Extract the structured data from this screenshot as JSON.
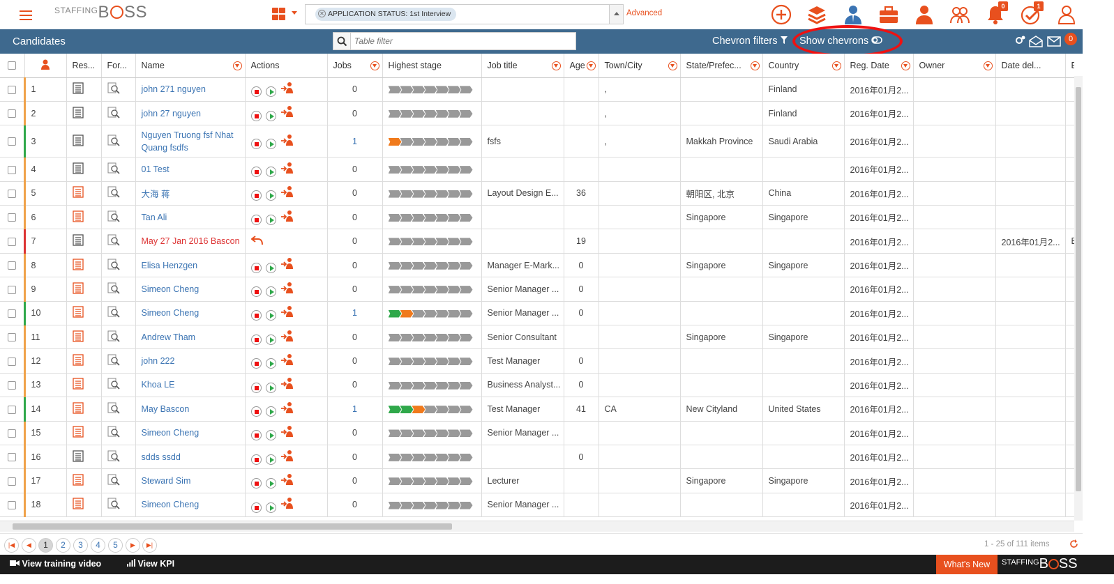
{
  "logo": {
    "small": "STAFFING",
    "big_b": "B",
    "big_rest": "SS"
  },
  "search": {
    "chip": "APPLICATION STATUS: 1st Interview",
    "advanced": "Advanced"
  },
  "badges": {
    "notifications": "0",
    "tasks": "1",
    "header": "0"
  },
  "colors": {
    "accent": "#e8501e",
    "header": "#3e698e",
    "link": "#3b74b3"
  },
  "toolbar": {
    "title": "Candidates",
    "filter_placeholder": "Table filter",
    "chevron_filters": "Chevron filters",
    "show_chevrons": "Show chevrons"
  },
  "columns": [
    "Res...",
    "For...",
    "Name",
    "Actions",
    "Jobs",
    "Highest stage",
    "Job title",
    "Age",
    "Town/City",
    "State/Prefec...",
    "Country",
    "Reg. Date",
    "Owner",
    "Date del...",
    "E"
  ],
  "rows": [
    {
      "n": "1",
      "name": "john 271 nguyen",
      "jobs": "0",
      "stage": [
        0,
        0
      ],
      "title": "",
      "age": "",
      "town": ",",
      "state": "",
      "country": "Finland",
      "reg": "2016年01月2...",
      "del": "",
      "res": "gray"
    },
    {
      "n": "2",
      "name": "john 27 nguyen",
      "jobs": "0",
      "stage": [
        0,
        0
      ],
      "title": "",
      "age": "",
      "town": ",",
      "state": "",
      "country": "Finland",
      "reg": "2016年01月2...",
      "del": "",
      "res": "gray"
    },
    {
      "n": "3",
      "name": "Nguyen Truong fsf Nhat Quang fsdfs",
      "jobs": "1",
      "stage": [
        0,
        1
      ],
      "title": "fsfs",
      "age": "",
      "town": ",",
      "state": "Makkah Province",
      "country": "Saudi Arabia",
      "reg": "2016年01月2...",
      "del": "",
      "res": "gray"
    },
    {
      "n": "4",
      "name": "01 Test",
      "jobs": "0",
      "stage": [
        0,
        0
      ],
      "title": "",
      "age": "",
      "town": "",
      "state": "",
      "country": "",
      "reg": "2016年01月2...",
      "del": "",
      "res": "gray"
    },
    {
      "n": "5",
      "name": "大海 蒋",
      "jobs": "0",
      "stage": [
        0,
        0
      ],
      "title": "Layout Design E...",
      "age": "36",
      "town": "",
      "state": "朝阳区, 北京",
      "country": "China",
      "reg": "2016年01月2...",
      "del": "",
      "res": "orange"
    },
    {
      "n": "6",
      "name": "Tan Ali",
      "jobs": "0",
      "stage": [
        0,
        0
      ],
      "title": "",
      "age": "",
      "town": "",
      "state": "Singapore",
      "country": "Singapore",
      "reg": "2016年01月2...",
      "del": "",
      "res": "orange"
    },
    {
      "n": "7",
      "name": "May 27 Jan 2016 Bascon",
      "jobs": "0",
      "stage": [
        0,
        0
      ],
      "title": "",
      "age": "19",
      "town": "",
      "state": "",
      "country": "",
      "reg": "2016年01月2...",
      "del": "2016年01月2...",
      "res": "gray",
      "deleted": true
    },
    {
      "n": "8",
      "name": "Elisa Henzgen",
      "jobs": "0",
      "stage": [
        0,
        0
      ],
      "title": "Manager E-Mark...",
      "age": "0",
      "town": "",
      "state": "Singapore",
      "country": "Singapore",
      "reg": "2016年01月2...",
      "del": "",
      "res": "orange"
    },
    {
      "n": "9",
      "name": "Simeon Cheng",
      "jobs": "0",
      "stage": [
        0,
        0
      ],
      "title": "Senior Manager ...",
      "age": "0",
      "town": "",
      "state": "",
      "country": "",
      "reg": "2016年01月2...",
      "del": "",
      "res": "orange"
    },
    {
      "n": "10",
      "name": "Simeon Cheng",
      "jobs": "1",
      "stage": [
        1,
        1
      ],
      "title": "Senior Manager ...",
      "age": "0",
      "town": "",
      "state": "",
      "country": "",
      "reg": "2016年01月2...",
      "del": "",
      "res": "orange"
    },
    {
      "n": "11",
      "name": "Andrew Tham",
      "jobs": "0",
      "stage": [
        0,
        0
      ],
      "title": "Senior Consultant",
      "age": "",
      "town": "",
      "state": "Singapore",
      "country": "Singapore",
      "reg": "2016年01月2...",
      "del": "",
      "res": "orange"
    },
    {
      "n": "12",
      "name": "john 222",
      "jobs": "0",
      "stage": [
        0,
        0
      ],
      "title": "Test Manager",
      "age": "0",
      "town": "",
      "state": "",
      "country": "",
      "reg": "2016年01月2...",
      "del": "",
      "res": "orange"
    },
    {
      "n": "13",
      "name": "Khoa LE",
      "jobs": "0",
      "stage": [
        0,
        0
      ],
      "title": "Business Analyst...",
      "age": "0",
      "town": "",
      "state": "",
      "country": "",
      "reg": "2016年01月2...",
      "del": "",
      "res": "orange"
    },
    {
      "n": "14",
      "name": "May Bascon",
      "jobs": "1",
      "stage": [
        2,
        1
      ],
      "title": "Test Manager",
      "age": "41",
      "town": "CA",
      "state": "New Cityland",
      "country": "United States",
      "reg": "2016年01月2...",
      "del": "",
      "res": "orange"
    },
    {
      "n": "15",
      "name": "Simeon Cheng",
      "jobs": "0",
      "stage": [
        0,
        0
      ],
      "title": "Senior Manager ...",
      "age": "",
      "town": "",
      "state": "",
      "country": "",
      "reg": "2016年01月2...",
      "del": "",
      "res": "orange"
    },
    {
      "n": "16",
      "name": "sdds ssdd",
      "jobs": "0",
      "stage": [
        0,
        0
      ],
      "title": "",
      "age": "0",
      "town": "",
      "state": "",
      "country": "",
      "reg": "2016年01月2...",
      "del": "",
      "res": "gray"
    },
    {
      "n": "17",
      "name": "Steward Sim",
      "jobs": "0",
      "stage": [
        0,
        0
      ],
      "title": "Lecturer",
      "age": "",
      "town": "",
      "state": "Singapore",
      "country": "Singapore",
      "reg": "2016年01月2...",
      "del": "",
      "res": "orange"
    },
    {
      "n": "18",
      "name": "Simeon Cheng",
      "jobs": "0",
      "stage": [
        0,
        0
      ],
      "title": "Senior Manager ...",
      "age": "",
      "town": "",
      "state": "",
      "country": "",
      "reg": "2016年01月2...",
      "del": "",
      "res": "orange"
    }
  ],
  "pager": {
    "pages": [
      "1",
      "2",
      "3",
      "4",
      "5"
    ],
    "current": "1",
    "info": "1 - 25 of 111 items"
  },
  "footer": {
    "training": "View training video",
    "kpi": "View KPI",
    "whats_new": "What's New"
  }
}
